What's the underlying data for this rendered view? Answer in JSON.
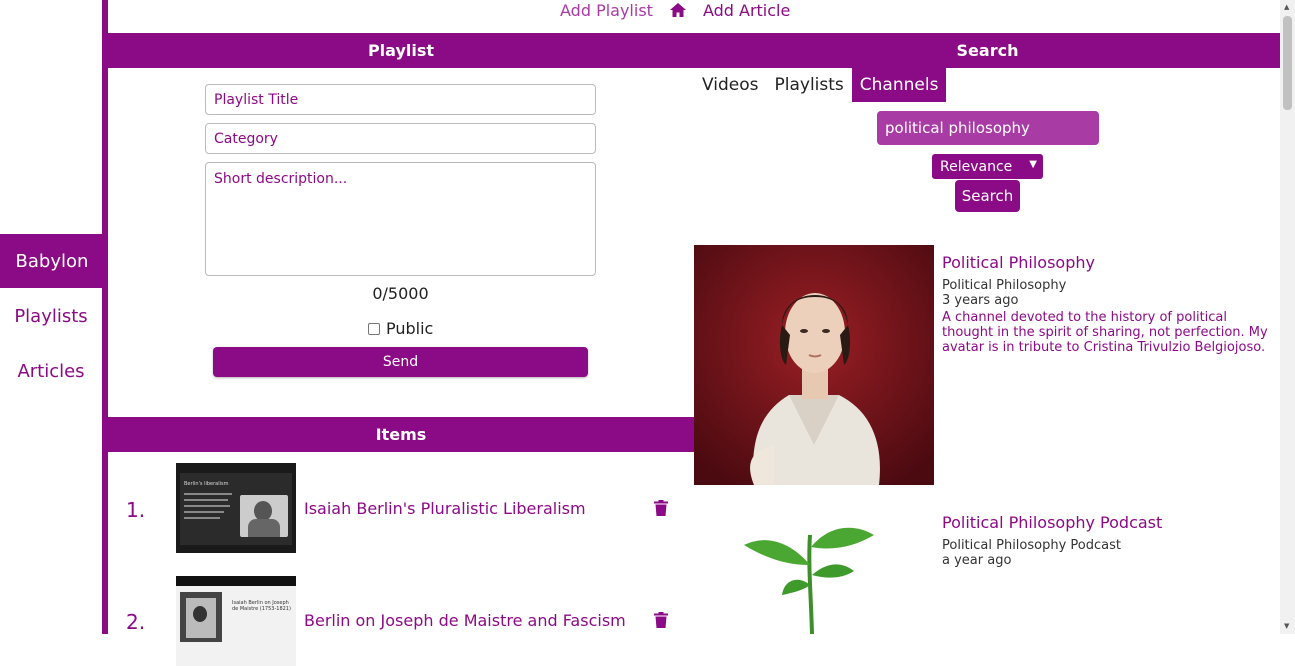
{
  "colors": {
    "accent": "#8b0a85",
    "accent_light": "#a83ba4"
  },
  "sidebar": {
    "items": [
      {
        "label": "Babylon",
        "active": true
      },
      {
        "label": "Playlists",
        "active": false
      },
      {
        "label": "Articles",
        "active": false
      }
    ]
  },
  "toplinks": {
    "add_playlist": "Add Playlist",
    "home_icon": "home-icon",
    "add_article": "Add Article"
  },
  "playlist": {
    "header": "Playlist",
    "title_placeholder": "Playlist Title",
    "category_placeholder": "Category",
    "description_placeholder": "Short description...",
    "counter": "0/5000",
    "public_label": "Public",
    "send_label": "Send"
  },
  "items": {
    "header": "Items",
    "list": [
      {
        "number": "1.",
        "title": "Isaiah Berlin's Pluralistic Liberalism",
        "thumb_text": "Berlin's liberalism"
      },
      {
        "number": "2.",
        "title": "Berlin on Joseph de Maistre and Fascism",
        "thumb_text": "Isaiah Berlin on Joseph de Maistre (1753-1821)"
      }
    ]
  },
  "search": {
    "header": "Search",
    "tabs": [
      {
        "label": "Videos",
        "active": false
      },
      {
        "label": "Playlists",
        "active": false
      },
      {
        "label": "Channels",
        "active": true
      }
    ],
    "query": "political philosophy",
    "sort": "Relevance",
    "button": "Search",
    "results": [
      {
        "title": "Political Philosophy",
        "channel": "Political Philosophy",
        "age": "3 years ago",
        "description": "A channel devoted to the history of political thought in the spirit of sharing, not perfection. My avatar is in tribute to Cristina Trivulzio Belgiojoso."
      },
      {
        "title": "Political Philosophy Podcast",
        "channel": "Political Philosophy Podcast",
        "age": "a year ago",
        "description": ""
      }
    ]
  }
}
